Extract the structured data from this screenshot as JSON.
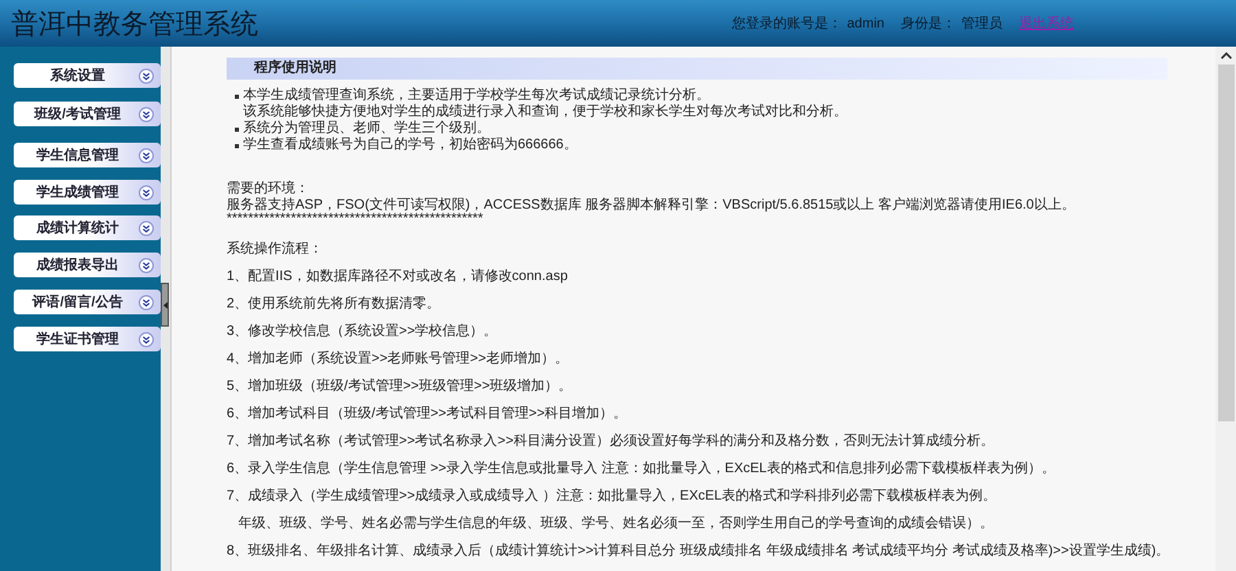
{
  "header": {
    "title": "普洱中教务管理系统",
    "account_label": "您登录的账号是：",
    "account": "admin",
    "role_label": "身份是：",
    "role": "管理员",
    "logout_link": "退出系统"
  },
  "sidebar": {
    "items": [
      {
        "label": "系统设置"
      },
      {
        "label": "班级/考试管理"
      },
      {
        "label": "学生信息管理"
      },
      {
        "label": "学生成绩管理"
      },
      {
        "label": "成绩计算统计"
      },
      {
        "label": "成绩报表导出"
      },
      {
        "label": "评语/留言/公告"
      },
      {
        "label": "学生证书管理"
      }
    ]
  },
  "notice": {
    "title": "程序使用说明",
    "bullets": [
      {
        "lines": [
          "本学生成绩管理查询系统，主要适用于学校学生每次考试成绩记录统计分析。",
          "该系统能够快捷方便地对学生的成绩进行录入和查询，便于学校和家长学生对每次考试对比和分析。"
        ]
      },
      {
        "lines": [
          "系统分为管理员、老师、学生三个级别。"
        ]
      },
      {
        "lines": [
          "学生查看成绩账号为自己的学号，初始密码为666666。"
        ]
      }
    ],
    "environment_title": "需要的环境：",
    "environment_text": "服务器支持ASP，FSO(文件可读写权限)，ACCESS数据库 服务器脚本解释引擎：VBScript/5.6.8515或以上 客户端浏览器请使用IE6.0以上。",
    "divider_stars": "************************************************",
    "steps_title": "系统操作流程：",
    "steps": [
      "1、配置IIS，如数据库路径不对或改名，请修改conn.asp",
      "2、使用系统前先将所有数据清零。",
      "3、修改学校信息（系统设置>>学校信息）。",
      "4、增加老师（系统设置>>老师账号管理>>老师增加）。",
      "5、增加班级（班级/考试管理>>班级管理>>班级增加）。",
      "6、增加考试科目（班级/考试管理>>考试科目管理>>科目增加）。",
      "7、增加考试名称（考试管理>>考试名称录入>>科目满分设置）必须设置好每学科的满分和及格分数，否则无法计算成绩分析。",
      "6、录入学生信息（学生信息管理 >>录入学生信息或批量导入 注意：如批量导入，EXcEL表的格式和信息排列必需下载模板样表为例）。",
      "7、成绩录入（学生成绩管理>>成绩录入或成绩导入 ）注意：如批量导入，EXcEL表的格式和学科排列必需下载模板样表为例。",
      "   年级、班级、学号、姓名必需与学生信息的年级、班级、学号、姓名必须一至，否则学生用自己的学号查询的成绩会错误）。",
      "8、班级排名、年级排名计算、成绩录入后（成绩计算统计>>计算科目总分 班级成绩排名 年级成绩排名 考试成绩平均分 考试成绩及格率)>>设置学生成绩)。"
    ]
  }
}
